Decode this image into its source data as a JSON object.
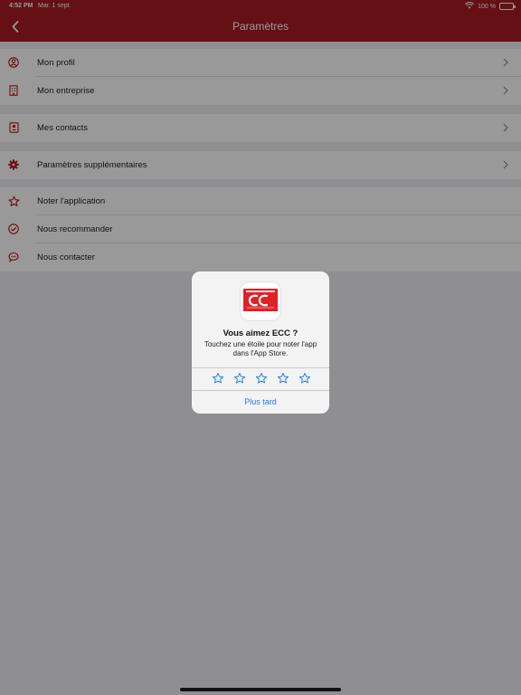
{
  "status_bar": {
    "time": "4:52 PM",
    "date": "Mar. 1 sept.",
    "battery": "100 %",
    "icons": [
      "wifi-icon",
      "battery-icon"
    ]
  },
  "nav": {
    "title": "Paramètres",
    "back_icon": "chevron-left-icon"
  },
  "colors": {
    "brand_red": "#a81c22",
    "accent_blue": "#1a7cf2",
    "icon_red": "#b5151c"
  },
  "settings": {
    "group1": [
      {
        "label": "Mon profil",
        "icon": "user-circle-icon"
      },
      {
        "label": "Mon entreprise",
        "icon": "building-icon"
      }
    ],
    "group2": [
      {
        "label": "Mes contacts",
        "icon": "contact-card-icon"
      }
    ],
    "group3": [
      {
        "label": "Paramètres supplémentaires",
        "icon": "gear-icon"
      }
    ],
    "group4": [
      {
        "label": "Noter l'application",
        "icon": "star-icon"
      },
      {
        "label": "Nous recommander",
        "icon": "check-circle-icon"
      },
      {
        "label": "Nous contacter",
        "icon": "chat-bubble-icon"
      }
    ]
  },
  "rating_dialog": {
    "title": "Vous aimez ECC ?",
    "message": "Touchez une étoile pour noter l'app dans l'App Store.",
    "stars": 5,
    "selected": 0,
    "later_label": "Plus tard"
  }
}
